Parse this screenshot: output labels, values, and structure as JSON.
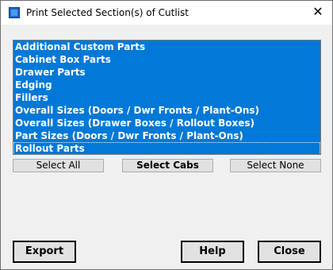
{
  "window": {
    "title": "Print Selected Section(s) of Cutlist",
    "close_glyph": "✕",
    "icon": "app-icon"
  },
  "sections_list": {
    "items": [
      {
        "label": "Additional Custom Parts",
        "selected": true
      },
      {
        "label": "Cabinet Box Parts",
        "selected": true
      },
      {
        "label": "Drawer Parts",
        "selected": true
      },
      {
        "label": "Edging",
        "selected": true
      },
      {
        "label": "Fillers",
        "selected": true
      },
      {
        "label": "Overall Sizes (Doors / Dwr Fronts / Plant-Ons)",
        "selected": true
      },
      {
        "label": "Overall Sizes (Drawer Boxes / Rollout Boxes)",
        "selected": true
      },
      {
        "label": "Part Sizes (Doors / Dwr Fronts / Plant-Ons)",
        "selected": true
      },
      {
        "label": "Rollout Parts",
        "selected": true,
        "focused": true
      }
    ],
    "selection_color": "#0078d7"
  },
  "selection_buttons": {
    "select_all": "Select All",
    "select_cabs": "Select Cabs",
    "select_none": "Select None"
  },
  "footer_buttons": {
    "export": "Export",
    "help": "Help",
    "close": "Close"
  }
}
